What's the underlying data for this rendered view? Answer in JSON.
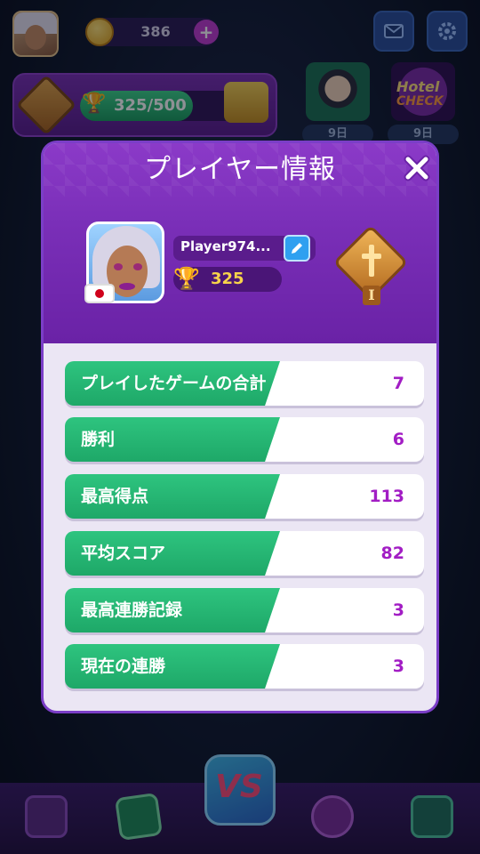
{
  "hud": {
    "coins": "386",
    "coin_plus": "+",
    "progress_text": "325/500",
    "progress_fraction": 0.65,
    "events": [
      {
        "timer": "9日"
      },
      {
        "title_line1": "Hotel",
        "title_line2": "CHECK",
        "timer": "9日"
      }
    ]
  },
  "modal": {
    "title": "プレイヤー情報",
    "close_symbol": "✖",
    "player_name": "Player974...",
    "trophies": "325",
    "rank_numeral": "I",
    "stats": [
      {
        "label": "プレイしたゲームの合計",
        "value": "7"
      },
      {
        "label": "勝利",
        "value": "6"
      },
      {
        "label": "最高得点",
        "value": "113"
      },
      {
        "label": "平均スコア",
        "value": "82"
      },
      {
        "label": "最高連勝記録",
        "value": "3"
      },
      {
        "label": "現在の連勝",
        "value": "3"
      }
    ]
  },
  "nav": {
    "vs_label": "VS"
  },
  "colors": {
    "accent_purple": "#7a2fb8",
    "stat_green": "#1ea868",
    "value_magenta": "#a21dc4",
    "trophy_gold": "#f7d34a"
  },
  "icons": [
    "mail-icon",
    "gear-icon",
    "coin-icon",
    "trophy-icon",
    "chest-icon",
    "close-icon",
    "edit-pencil-icon",
    "rank-badge-icon",
    "flag-japan-icon",
    "shop-icon",
    "cards-icon",
    "rank-star-icon",
    "friends-icon"
  ]
}
